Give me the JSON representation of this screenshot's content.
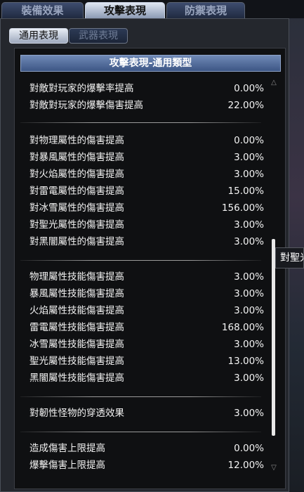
{
  "top_tabs": [
    {
      "label": "裝備效果",
      "active": false
    },
    {
      "label": "攻擊表現",
      "active": true
    },
    {
      "label": "防禦表現",
      "active": false
    }
  ],
  "sub_tabs": [
    {
      "label": "通用表現",
      "active": true
    },
    {
      "label": "武器表現",
      "active": false
    }
  ],
  "panel_title": "攻擊表現-通用類型",
  "groups": [
    {
      "rows": [
        {
          "label": "對敵對玩家的爆擊率提高",
          "value": "0.00%"
        },
        {
          "label": "對敵對玩家的爆擊傷害提高",
          "value": "22.00%"
        }
      ]
    },
    {
      "rows": [
        {
          "label": "對物理屬性的傷害提高",
          "value": "0.00%"
        },
        {
          "label": "對暴風屬性的傷害提高",
          "value": "3.00%"
        },
        {
          "label": "對火焰屬性的傷害提高",
          "value": "3.00%"
        },
        {
          "label": "對雷電屬性的傷害提高",
          "value": "15.00%"
        },
        {
          "label": "對冰雪屬性的傷害提高",
          "value": "156.00%"
        },
        {
          "label": "對聖光屬性的傷害提高",
          "value": "3.00%"
        },
        {
          "label": "對黑闇屬性的傷害提高",
          "value": "3.00%"
        }
      ]
    },
    {
      "rows": [
        {
          "label": "物理屬性技能傷害提高",
          "value": "3.00%"
        },
        {
          "label": "暴風屬性技能傷害提高",
          "value": "3.00%"
        },
        {
          "label": "火焰屬性技能傷害提高",
          "value": "3.00%"
        },
        {
          "label": "雷電屬性技能傷害提高",
          "value": "168.00%"
        },
        {
          "label": "冰雪屬性技能傷害提高",
          "value": "3.00%"
        },
        {
          "label": "聖光屬性技能傷害提高",
          "value": "13.00%"
        },
        {
          "label": "黑闇屬性技能傷害提高",
          "value": "3.00%"
        }
      ]
    },
    {
      "rows": [
        {
          "label": "對韌性怪物的穿透效果",
          "value": "3.00%"
        }
      ]
    },
    {
      "rows": [
        {
          "label": "造成傷害上限提高",
          "value": "0.00%"
        },
        {
          "label": "爆擊傷害上限提高",
          "value": "12.00%"
        }
      ]
    }
  ],
  "tooltip_text": "對聖光",
  "icons": {
    "scroll_up": "scroll-up-arrow-icon",
    "scroll_down": "scroll-down-arrow-icon"
  }
}
